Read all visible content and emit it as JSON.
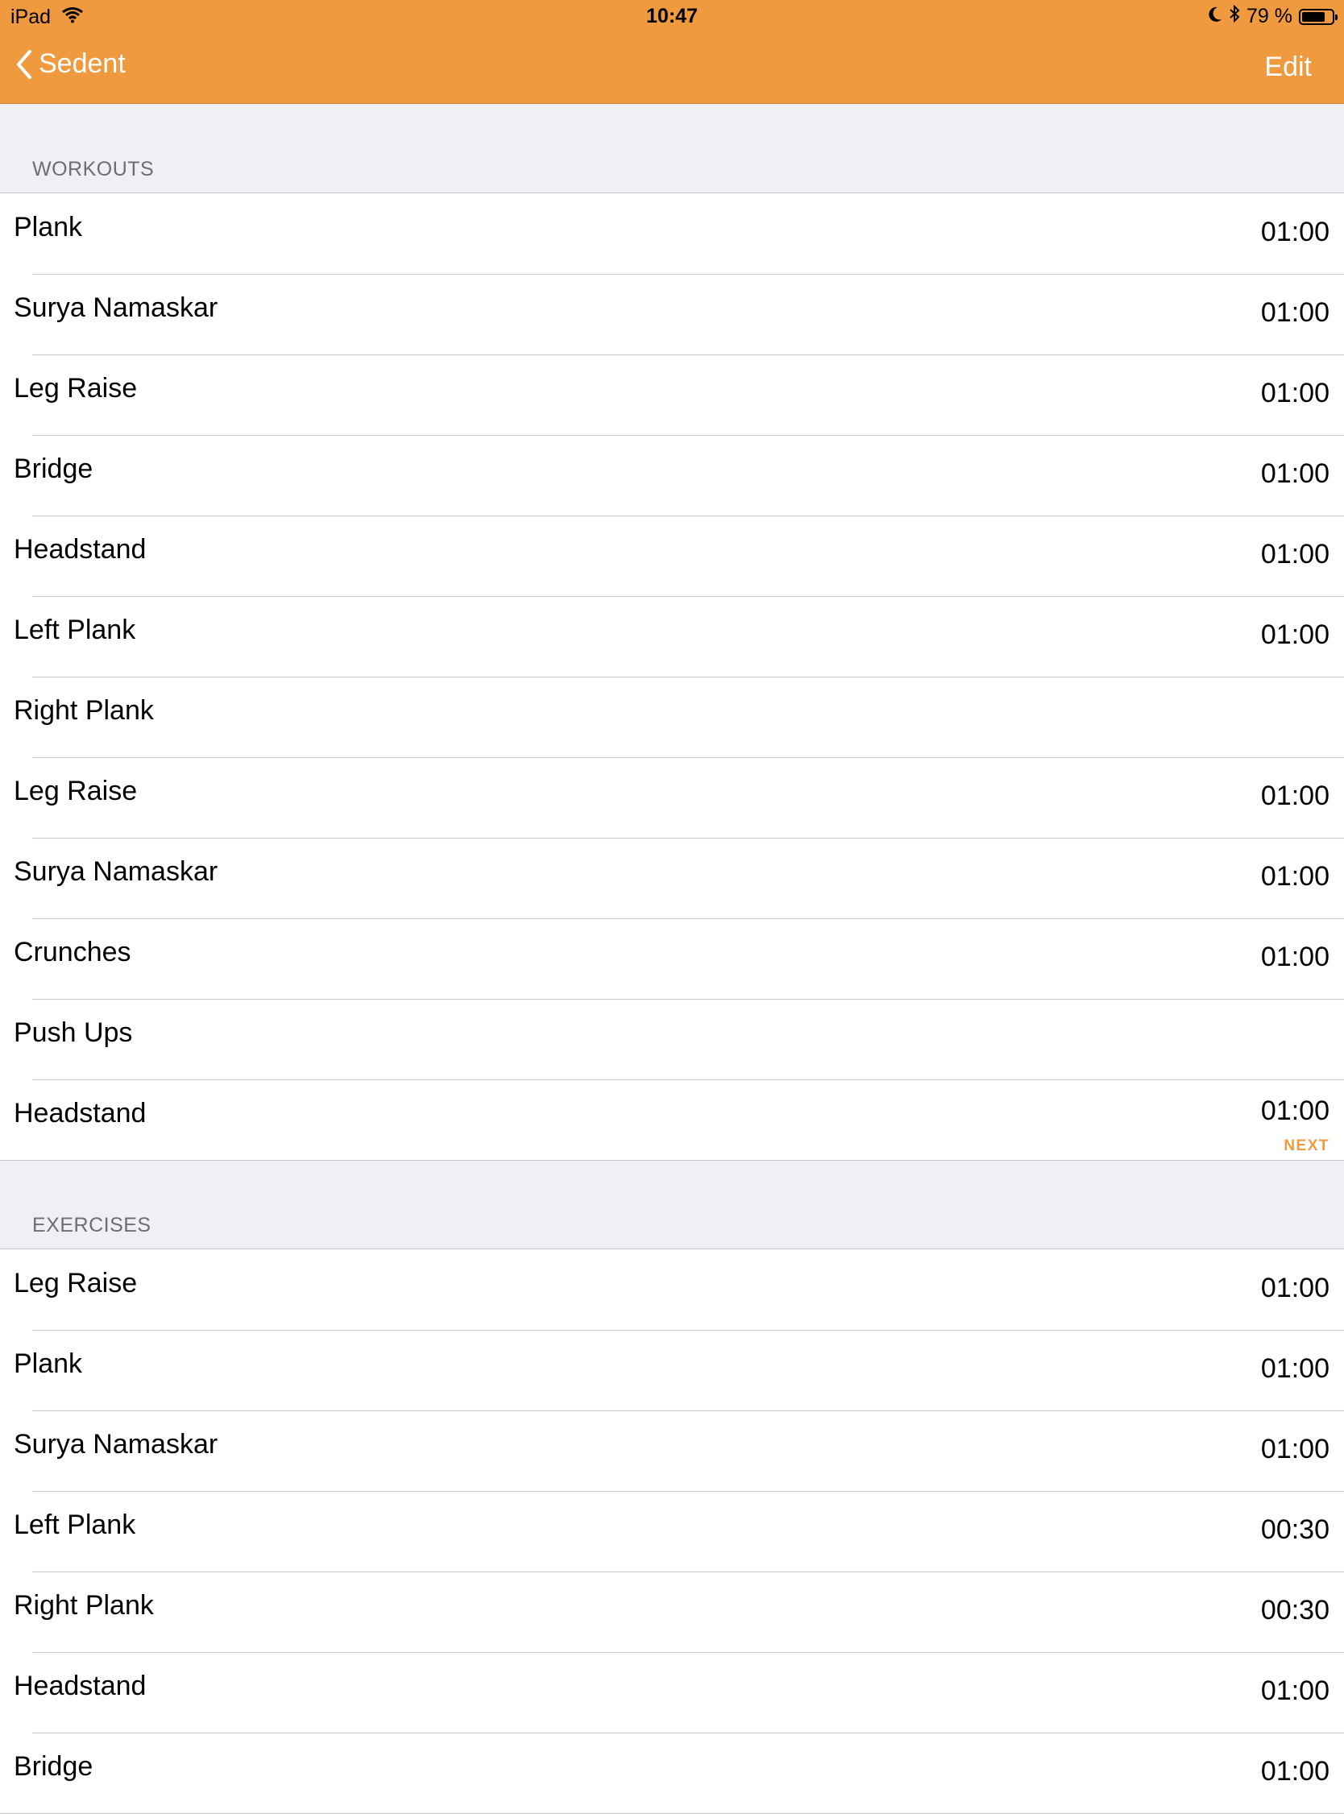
{
  "status_bar": {
    "device": "iPad",
    "time": "10:47",
    "battery_label": "79 %",
    "battery_percent": 79
  },
  "nav": {
    "back_label": "Sedent",
    "edit_label": "Edit",
    "accent_color": "#f09a40"
  },
  "workouts": {
    "header": "WORKOUTS",
    "rows": [
      {
        "name": "Plank",
        "duration": "01:00"
      },
      {
        "name": "Surya Namaskar",
        "duration": "01:00"
      },
      {
        "name": "Leg Raise",
        "duration": "01:00"
      },
      {
        "name": "Bridge",
        "duration": "01:00"
      },
      {
        "name": "Headstand",
        "duration": "01:00"
      },
      {
        "name": "Left Plank",
        "duration": "01:00"
      },
      {
        "name": "Right Plank",
        "duration": ""
      },
      {
        "name": "Leg Raise",
        "duration": "01:00"
      },
      {
        "name": "Surya Namaskar",
        "duration": "01:00"
      },
      {
        "name": "Crunches",
        "duration": "01:00"
      },
      {
        "name": "Push Ups",
        "duration": ""
      },
      {
        "name": "Headstand",
        "duration": "01:00",
        "badge": "NEXT"
      }
    ]
  },
  "exercises": {
    "header": "EXERCISES",
    "rows": [
      {
        "name": "Leg Raise",
        "duration": "01:00"
      },
      {
        "name": "Plank",
        "duration": "01:00"
      },
      {
        "name": "Surya Namaskar",
        "duration": "01:00"
      },
      {
        "name": "Left Plank",
        "duration": "00:30"
      },
      {
        "name": "Right Plank",
        "duration": "00:30"
      },
      {
        "name": "Headstand",
        "duration": "01:00"
      },
      {
        "name": "Bridge",
        "duration": "01:00"
      }
    ]
  }
}
